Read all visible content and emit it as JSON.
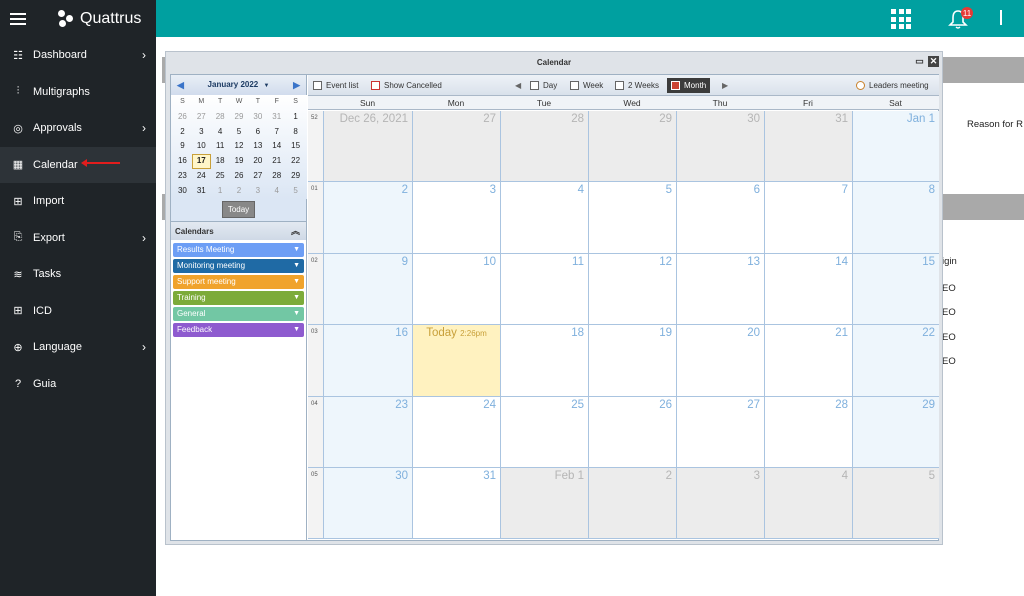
{
  "brand": {
    "name": "Quattrus"
  },
  "sidebar": {
    "items": [
      {
        "label": "Dashboard",
        "icon": "dashboard-icon",
        "chevron": true
      },
      {
        "label": "Multigraphs",
        "icon": "chart-icon",
        "chevron": false
      },
      {
        "label": "Approvals",
        "icon": "approvals-icon",
        "chevron": true
      },
      {
        "label": "Calendar",
        "icon": "calendar-icon",
        "chevron": false,
        "active": true
      },
      {
        "label": "Import",
        "icon": "import-icon",
        "chevron": false
      },
      {
        "label": "Export",
        "icon": "export-icon",
        "chevron": true
      },
      {
        "label": "Tasks",
        "icon": "tasks-icon",
        "chevron": false
      },
      {
        "label": "ICD",
        "icon": "icd-icon",
        "chevron": false
      },
      {
        "label": "Language",
        "icon": "globe-icon",
        "chevron": true
      },
      {
        "label": "Guia",
        "icon": "help-icon",
        "chevron": false
      }
    ]
  },
  "topbar": {
    "notification_count": "11",
    "accent": "#00a0a0"
  },
  "background_page": {
    "reason_text": "Reason for R",
    "origin_text": "igin",
    "row_texts": [
      "EO",
      "EO",
      "EO",
      "EO"
    ]
  },
  "window": {
    "title": "Calendar",
    "mini_calendar": {
      "month_label": "January 2022",
      "dow": [
        "S",
        "M",
        "T",
        "W",
        "T",
        "F",
        "S"
      ],
      "weeks": [
        [
          "26",
          "27",
          "28",
          "29",
          "30",
          "31",
          "1"
        ],
        [
          "2",
          "3",
          "4",
          "5",
          "6",
          "7",
          "8"
        ],
        [
          "9",
          "10",
          "11",
          "12",
          "13",
          "14",
          "15"
        ],
        [
          "16",
          "17",
          "18",
          "19",
          "20",
          "21",
          "22"
        ],
        [
          "23",
          "24",
          "25",
          "26",
          "27",
          "28",
          "29"
        ],
        [
          "30",
          "31",
          "1",
          "2",
          "3",
          "4",
          "5"
        ]
      ],
      "today_button": "Today"
    },
    "calendars": {
      "header": "Calendars",
      "items": [
        {
          "label": "Results Meeting",
          "color": "#6d9ef5"
        },
        {
          "label": "Monitoring meeting",
          "color": "#1f6aa5"
        },
        {
          "label": "Support meeting",
          "color": "#f0a32c"
        },
        {
          "label": "Training",
          "color": "#7cab3a"
        },
        {
          "label": "General",
          "color": "#72c7a4"
        },
        {
          "label": "Feedback",
          "color": "#8e5bcf"
        }
      ]
    },
    "toolbar": {
      "event_list": "Event list",
      "show_cancelled": "Show Cancelled",
      "day": "Day",
      "week": "Week",
      "two_weeks": "2 Weeks",
      "month": "Month",
      "leaders": "Leaders meeting"
    },
    "dow_headers": [
      "Sun",
      "Mon",
      "Tue",
      "Wed",
      "Thu",
      "Fri",
      "Sat"
    ],
    "weeks": [
      {
        "num": "52",
        "days": [
          "Dec 26, 2021",
          "27",
          "28",
          "29",
          "30",
          "31",
          "Jan 1"
        ]
      },
      {
        "num": "01",
        "days": [
          "2",
          "3",
          "4",
          "5",
          "6",
          "7",
          "8"
        ]
      },
      {
        "num": "02",
        "days": [
          "9",
          "10",
          "11",
          "12",
          "13",
          "14",
          "15"
        ]
      },
      {
        "num": "03",
        "days": [
          "16",
          "Today",
          "18",
          "19",
          "20",
          "21",
          "22"
        ]
      },
      {
        "num": "04",
        "days": [
          "23",
          "24",
          "25",
          "26",
          "27",
          "28",
          "29"
        ]
      },
      {
        "num": "05",
        "days": [
          "30",
          "31",
          "Feb 1",
          "2",
          "3",
          "4",
          "5"
        ]
      }
    ],
    "today_time": "2:26pm"
  }
}
